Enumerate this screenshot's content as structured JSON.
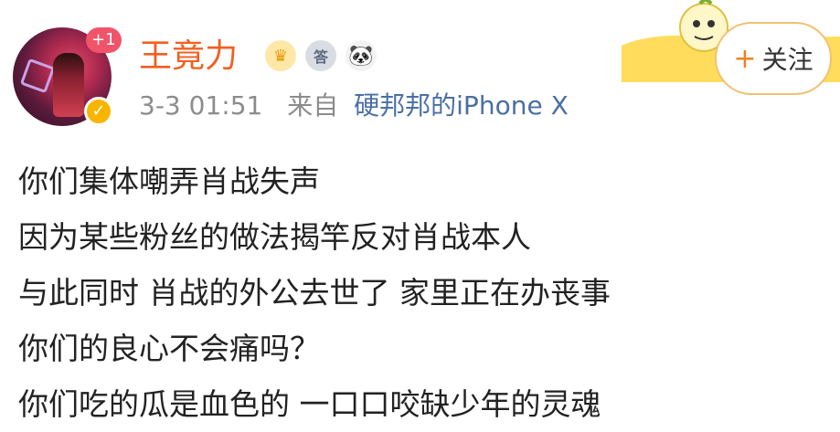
{
  "post": {
    "badge_count": "+1",
    "username": "王竟力",
    "medal_text": "答",
    "time": "3-3 01:51",
    "source_prefix": "来自",
    "source_device": "硬邦邦的iPhone X",
    "follow_label": "关注",
    "follow_plus": "+",
    "lines": [
      "你们集体嘲弄肖战失声",
      "因为某些粉丝的做法揭竿反对肖战本人",
      "与此同时 肖战的外公去世了 家里正在办丧事",
      "你们的良心不会痛吗？",
      "你们吃的瓜是血色的 一口口咬缺少年的灵魂"
    ]
  },
  "colors": {
    "username": "#f06020",
    "device_link": "#4a6fa5",
    "meta": "#8c8c8c",
    "deco_yellow": "#ffd84a"
  }
}
